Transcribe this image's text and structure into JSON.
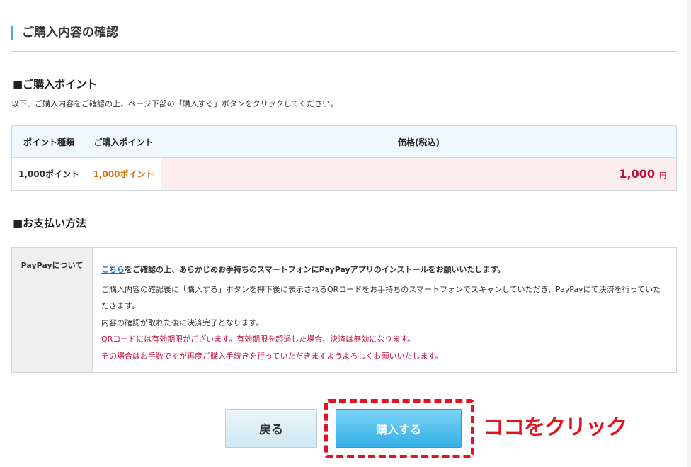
{
  "page_title": "ご購入内容の確認",
  "points_section": {
    "heading": "■ご購入ポイント",
    "lead": "以下、ご購入内容をご確認の上、ページ下部の「購入する」ボタンをクリックしてください。",
    "columns": [
      "ポイント種類",
      "ご購入ポイント",
      "価格(税込)"
    ],
    "row": {
      "type": "1,000ポイント",
      "points": "1,000ポイント",
      "price": "1,000",
      "unit": "円"
    }
  },
  "payment_section": {
    "heading": "■お支払い方法",
    "label": "PayPayについて",
    "link_text": "こちら",
    "first_line_rest": "をご確認の上、あらかじめお手持ちのスマートフォンにPayPayアプリのインストールをお願いいたします。",
    "line2": "ご購入内容の確認後に「購入する」ボタンを押下後に表示されるQRコードをお手持ちのスマートフォンでスキャンしていただき、PayPayにて決済を行っていただきます。",
    "line3": "内容の確認が取れた後に決済完了となります。",
    "warn1": "QRコードには有効期限がございます。有効期限を超過した場合、決済は無効になります。",
    "warn2": "その場合はお手数ですが再度ご購入手続きを行っていただきますようよろしくお願いいたします。"
  },
  "buttons": {
    "back": "戻る",
    "buy": "購入する"
  },
  "annotation": "ココをクリック",
  "colors": {
    "accent": "#4aaad6",
    "price_red": "#c4123f",
    "points_orange": "#d47514",
    "annotation_red": "#e1141f"
  }
}
